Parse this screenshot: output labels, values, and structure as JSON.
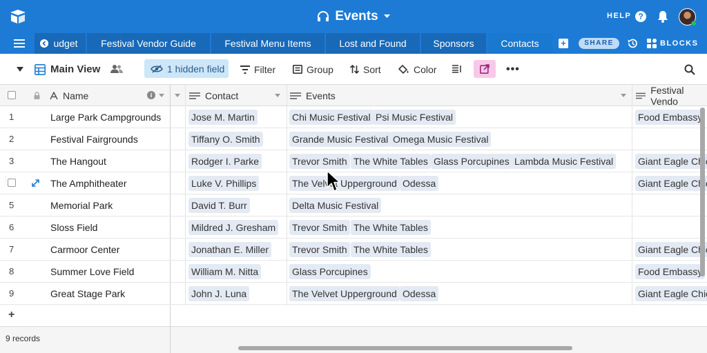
{
  "app": {
    "base_title": "Events",
    "help_label": "HELP",
    "colors": {
      "topbar": "#1d7bd5",
      "accent_selected": "#cde6f8",
      "chip": "#e4eaf3"
    }
  },
  "tabs": [
    {
      "label": "udget"
    },
    {
      "label": "Festival Vendor Guide"
    },
    {
      "label": "Festival Menu Items"
    },
    {
      "label": "Lost and Found"
    },
    {
      "label": "Sponsors"
    },
    {
      "label": "Contacts"
    }
  ],
  "tabbar": {
    "share_label": "SHARE",
    "blocks_label": "BLOCKS"
  },
  "toolbar": {
    "view_name": "Main View",
    "hidden_fields": "1 hidden field",
    "filter": "Filter",
    "group": "Group",
    "sort": "Sort",
    "color": "Color"
  },
  "columns": {
    "name": "Name",
    "contact": "Contact",
    "events": "Events",
    "vendor": "Festival Vendo"
  },
  "rows": [
    {
      "num": "1",
      "name": "Large Park Campgrounds",
      "contact": "Jose M. Martin",
      "events": [
        "Chi Music Festival",
        "Psi Music Festival"
      ],
      "vendor": "Food Embassy"
    },
    {
      "num": "2",
      "name": "Festival Fairgrounds",
      "contact": "Tiffany O. Smith",
      "events": [
        "Grande Music Festival",
        "Omega Music Festival"
      ],
      "vendor": ""
    },
    {
      "num": "3",
      "name": "The Hangout",
      "contact": "Rodger I. Parke",
      "events": [
        "Trevor Smith",
        "The White Tables",
        "Glass Porcupines",
        "Lambda Music Festival"
      ],
      "vendor": "Giant Eagle Chic"
    },
    {
      "num": "",
      "name": "The Amphitheater",
      "contact": "Luke V. Phillips",
      "events": [
        "The Velvet Upperground",
        "Odessa"
      ],
      "vendor": "Giant Eagle Chic"
    },
    {
      "num": "5",
      "name": "Memorial Park",
      "contact": "David T. Burr",
      "events": [
        "Delta Music Festival"
      ],
      "vendor": ""
    },
    {
      "num": "6",
      "name": "Sloss Field",
      "contact": "Mildred J. Gresham",
      "events": [
        "Trevor Smith",
        "The White Tables"
      ],
      "vendor": ""
    },
    {
      "num": "7",
      "name": "Carmoor Center",
      "contact": "Jonathan E. Miller",
      "events": [
        "Trevor Smith",
        "The White Tables"
      ],
      "vendor": "Giant Eagle Chic"
    },
    {
      "num": "8",
      "name": "Summer Love Field",
      "contact": "William M. Nitta",
      "events": [
        "Glass Porcupines"
      ],
      "vendor": "Food Embassy"
    },
    {
      "num": "9",
      "name": "Great Stage Park",
      "contact": "John J. Luna",
      "events": [
        "The Velvet Upperground",
        "Odessa"
      ],
      "vendor": "Giant Eagle Chic"
    }
  ],
  "footer": {
    "records": "9 records",
    "add_row": "+"
  }
}
